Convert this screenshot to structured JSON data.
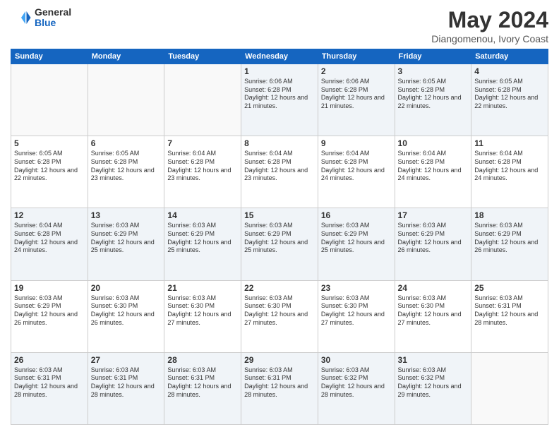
{
  "logo": {
    "general": "General",
    "blue": "Blue"
  },
  "header": {
    "title": "May 2024",
    "subtitle": "Diangomenou, Ivory Coast"
  },
  "weekdays": [
    "Sunday",
    "Monday",
    "Tuesday",
    "Wednesday",
    "Thursday",
    "Friday",
    "Saturday"
  ],
  "weeks": [
    [
      {
        "day": "",
        "info": ""
      },
      {
        "day": "",
        "info": ""
      },
      {
        "day": "",
        "info": ""
      },
      {
        "day": "1",
        "info": "Sunrise: 6:06 AM\nSunset: 6:28 PM\nDaylight: 12 hours and 21 minutes."
      },
      {
        "day": "2",
        "info": "Sunrise: 6:06 AM\nSunset: 6:28 PM\nDaylight: 12 hours and 21 minutes."
      },
      {
        "day": "3",
        "info": "Sunrise: 6:05 AM\nSunset: 6:28 PM\nDaylight: 12 hours and 22 minutes."
      },
      {
        "day": "4",
        "info": "Sunrise: 6:05 AM\nSunset: 6:28 PM\nDaylight: 12 hours and 22 minutes."
      }
    ],
    [
      {
        "day": "5",
        "info": "Sunrise: 6:05 AM\nSunset: 6:28 PM\nDaylight: 12 hours and 22 minutes."
      },
      {
        "day": "6",
        "info": "Sunrise: 6:05 AM\nSunset: 6:28 PM\nDaylight: 12 hours and 23 minutes."
      },
      {
        "day": "7",
        "info": "Sunrise: 6:04 AM\nSunset: 6:28 PM\nDaylight: 12 hours and 23 minutes."
      },
      {
        "day": "8",
        "info": "Sunrise: 6:04 AM\nSunset: 6:28 PM\nDaylight: 12 hours and 23 minutes."
      },
      {
        "day": "9",
        "info": "Sunrise: 6:04 AM\nSunset: 6:28 PM\nDaylight: 12 hours and 24 minutes."
      },
      {
        "day": "10",
        "info": "Sunrise: 6:04 AM\nSunset: 6:28 PM\nDaylight: 12 hours and 24 minutes."
      },
      {
        "day": "11",
        "info": "Sunrise: 6:04 AM\nSunset: 6:28 PM\nDaylight: 12 hours and 24 minutes."
      }
    ],
    [
      {
        "day": "12",
        "info": "Sunrise: 6:04 AM\nSunset: 6:28 PM\nDaylight: 12 hours and 24 minutes."
      },
      {
        "day": "13",
        "info": "Sunrise: 6:03 AM\nSunset: 6:29 PM\nDaylight: 12 hours and 25 minutes."
      },
      {
        "day": "14",
        "info": "Sunrise: 6:03 AM\nSunset: 6:29 PM\nDaylight: 12 hours and 25 minutes."
      },
      {
        "day": "15",
        "info": "Sunrise: 6:03 AM\nSunset: 6:29 PM\nDaylight: 12 hours and 25 minutes."
      },
      {
        "day": "16",
        "info": "Sunrise: 6:03 AM\nSunset: 6:29 PM\nDaylight: 12 hours and 25 minutes."
      },
      {
        "day": "17",
        "info": "Sunrise: 6:03 AM\nSunset: 6:29 PM\nDaylight: 12 hours and 26 minutes."
      },
      {
        "day": "18",
        "info": "Sunrise: 6:03 AM\nSunset: 6:29 PM\nDaylight: 12 hours and 26 minutes."
      }
    ],
    [
      {
        "day": "19",
        "info": "Sunrise: 6:03 AM\nSunset: 6:29 PM\nDaylight: 12 hours and 26 minutes."
      },
      {
        "day": "20",
        "info": "Sunrise: 6:03 AM\nSunset: 6:30 PM\nDaylight: 12 hours and 26 minutes."
      },
      {
        "day": "21",
        "info": "Sunrise: 6:03 AM\nSunset: 6:30 PM\nDaylight: 12 hours and 27 minutes."
      },
      {
        "day": "22",
        "info": "Sunrise: 6:03 AM\nSunset: 6:30 PM\nDaylight: 12 hours and 27 minutes."
      },
      {
        "day": "23",
        "info": "Sunrise: 6:03 AM\nSunset: 6:30 PM\nDaylight: 12 hours and 27 minutes."
      },
      {
        "day": "24",
        "info": "Sunrise: 6:03 AM\nSunset: 6:30 PM\nDaylight: 12 hours and 27 minutes."
      },
      {
        "day": "25",
        "info": "Sunrise: 6:03 AM\nSunset: 6:31 PM\nDaylight: 12 hours and 28 minutes."
      }
    ],
    [
      {
        "day": "26",
        "info": "Sunrise: 6:03 AM\nSunset: 6:31 PM\nDaylight: 12 hours and 28 minutes."
      },
      {
        "day": "27",
        "info": "Sunrise: 6:03 AM\nSunset: 6:31 PM\nDaylight: 12 hours and 28 minutes."
      },
      {
        "day": "28",
        "info": "Sunrise: 6:03 AM\nSunset: 6:31 PM\nDaylight: 12 hours and 28 minutes."
      },
      {
        "day": "29",
        "info": "Sunrise: 6:03 AM\nSunset: 6:31 PM\nDaylight: 12 hours and 28 minutes."
      },
      {
        "day": "30",
        "info": "Sunrise: 6:03 AM\nSunset: 6:32 PM\nDaylight: 12 hours and 28 minutes."
      },
      {
        "day": "31",
        "info": "Sunrise: 6:03 AM\nSunset: 6:32 PM\nDaylight: 12 hours and 29 minutes."
      },
      {
        "day": "",
        "info": ""
      }
    ]
  ]
}
